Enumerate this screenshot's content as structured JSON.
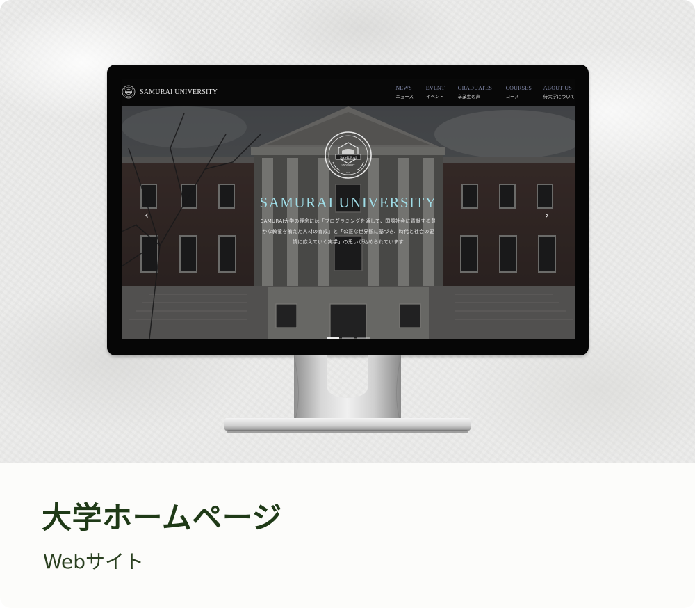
{
  "site": {
    "brand": "SAMURAI UNIVERSITY",
    "nav": [
      {
        "en": "NEWS",
        "ja": "ニュース"
      },
      {
        "en": "EVENT",
        "ja": "イベント"
      },
      {
        "en": "GRADUATES",
        "ja": "卒業生の声"
      },
      {
        "en": "COURSES",
        "ja": "コース"
      },
      {
        "en": "ABOUT US",
        "ja": "侍大学について"
      }
    ],
    "hero": {
      "title": "SAMURAI UNIVERSITY",
      "lines": [
        "SAMURAI大学の理念には「プログラミングを通して、国際社会に貢献する豊",
        "かな教養を備えた人材の育成」と「公正な世界観に基づき、時代と社会の要",
        "請に応えていく実学」の思いが込められています"
      ],
      "emblem_text": "SAMURAI",
      "emblem_sub": "UNIVERSITY",
      "emblem_year": "1924",
      "prev_icon": "chevron-left-icon",
      "next_icon": "chevron-right-icon",
      "slide_count": 3,
      "active_slide": 1
    }
  },
  "caption": {
    "title": "大学ホームページ",
    "subtitle": "Webサイト"
  },
  "colors": {
    "title_green": "#1f3a17",
    "hero_title": "#9fdce6",
    "nav_en": "#7f86a6"
  }
}
